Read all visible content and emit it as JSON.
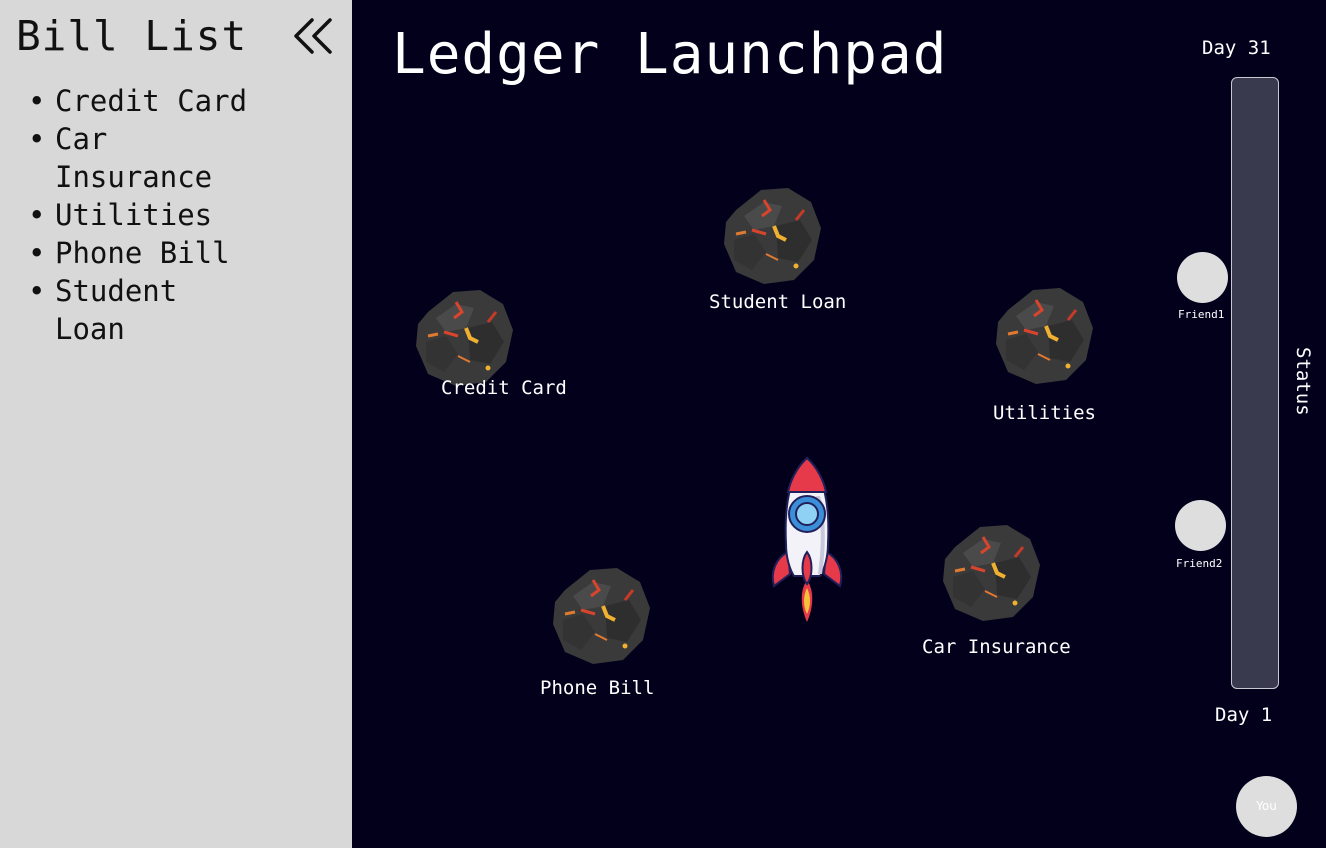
{
  "sidebar": {
    "title": "Bill List",
    "collapse_icon": "double-chevron-left-icon",
    "items": [
      {
        "label": "Credit Card"
      },
      {
        "label": "Car Insurance"
      },
      {
        "label": "Utilities"
      },
      {
        "label": "Phone Bill"
      },
      {
        "label": "Student Loan"
      }
    ]
  },
  "main": {
    "title": "Ledger Launchpad",
    "asteroids": [
      {
        "label": "Student Loan"
      },
      {
        "label": "Credit Card"
      },
      {
        "label": "Utilities"
      },
      {
        "label": "Phone Bill"
      },
      {
        "label": "Car Insurance"
      }
    ],
    "rocket_icon": "rocket-icon"
  },
  "status": {
    "top_label": "Day 31",
    "bottom_label": "Day 1",
    "label": "Status",
    "friends": [
      {
        "name": "Friend1"
      },
      {
        "name": "Friend2"
      }
    ],
    "you_label": "You"
  },
  "colors": {
    "sidebar_bg": "#d8d8d8",
    "space_bg": "#03001c",
    "status_bar": "#3a3a4e",
    "rocket_red": "#e63a4a",
    "rocket_blue": "#3b8fd9"
  }
}
